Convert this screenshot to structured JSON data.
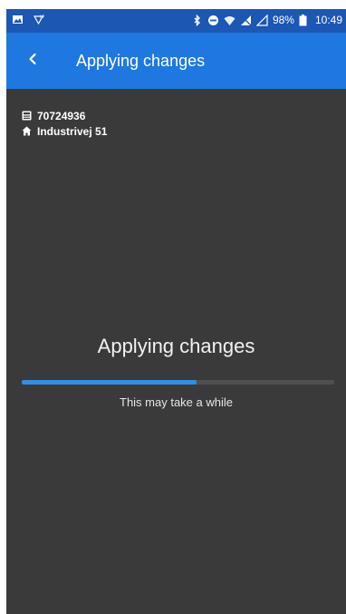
{
  "status_bar": {
    "battery_percent": "98%",
    "time": "10:49"
  },
  "app_bar": {
    "back_icon": "chevron-left-icon",
    "title": "Applying changes"
  },
  "info": {
    "id_icon": "calculator-icon",
    "id_value": "70724936",
    "address_icon": "home-icon",
    "address_value": "Industrivej 51"
  },
  "main": {
    "heading": "Applying changes",
    "progress": 0.56,
    "subtext": "This may take a while"
  },
  "colors": {
    "status_bar": "#1b57b3",
    "app_bar": "#1f78e0",
    "background": "#3a3a3a",
    "progress_fill": "#2f8fe8",
    "progress_track": "#4f4f4f"
  }
}
